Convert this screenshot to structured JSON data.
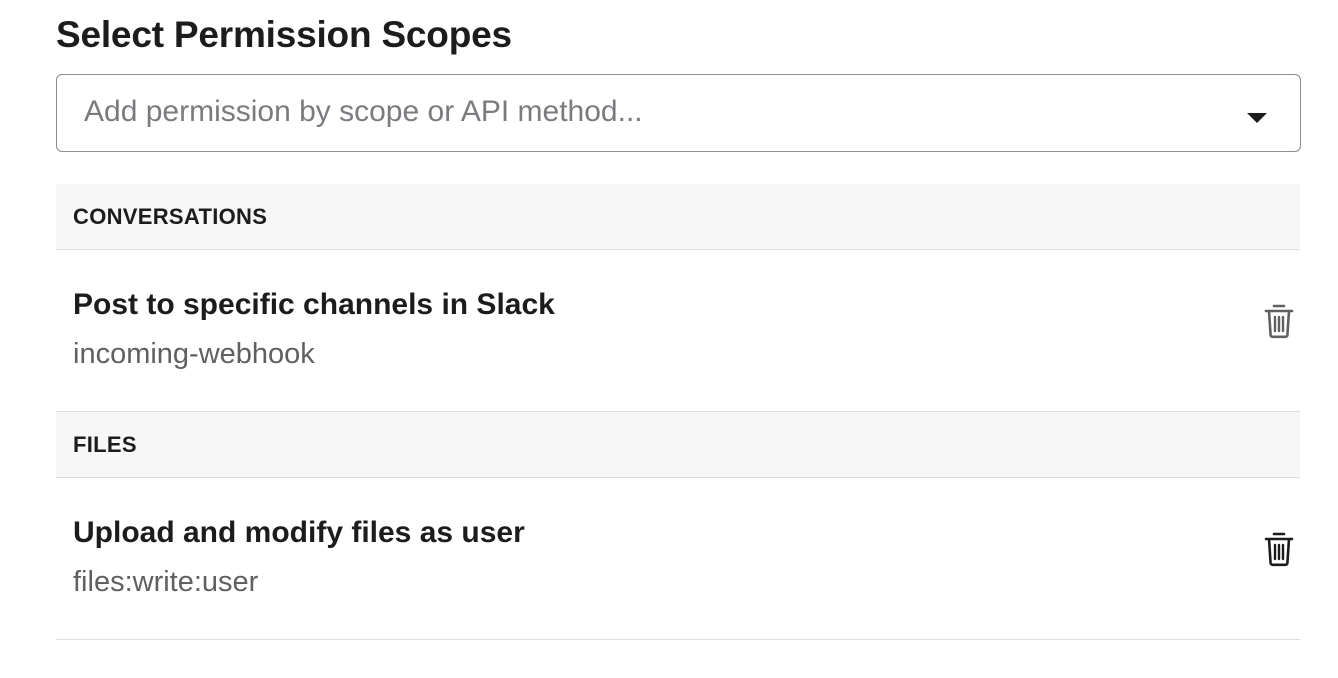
{
  "page": {
    "title": "Select Permission Scopes"
  },
  "scope_select": {
    "placeholder": "Add permission by scope or API method...",
    "dropdown_icon": "chevron-down-icon"
  },
  "sections": [
    {
      "header": "CONVERSATIONS",
      "scopes": [
        {
          "title": "Post to specific channels in Slack",
          "scope": "incoming-webhook",
          "remove_icon": "trash-icon"
        }
      ]
    },
    {
      "header": "FILES",
      "scopes": [
        {
          "title": "Upload and modify files as user",
          "scope": "files:write:user",
          "remove_icon": "trash-icon"
        }
      ]
    }
  ],
  "colors": {
    "text": "#1d1c1d",
    "secondary_text": "#616061",
    "placeholder": "#7c7a7f",
    "section_bg": "#f7f7f7",
    "divider": "#dddddd",
    "border": "#8d8d8f"
  }
}
